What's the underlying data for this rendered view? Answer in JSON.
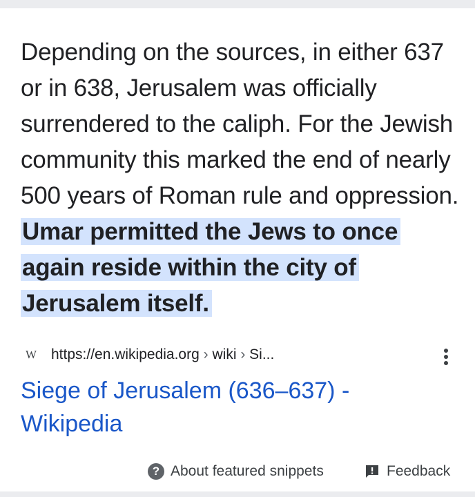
{
  "snippet": {
    "text": "Depending on the sources, in either 637 or in 638, Jerusalem was officially surrendered to the caliph. For the Jewish community this marked the end of nearly 500 years of Roman rule and oppression. ",
    "highlight": "Umar permitted the Jews to once again reside within the city of Jerusalem itself."
  },
  "source": {
    "favicon": "W",
    "url_base": "https://en.wikipedia.org",
    "crumb_1": "wiki",
    "crumb_2": "Si...",
    "separator": "›",
    "more_icon": "more-vertical-icon"
  },
  "result": {
    "title": "Siege of Jerusalem (636–637) - Wikipedia"
  },
  "footer": {
    "about_icon": "?",
    "about_label": "About featured snippets",
    "feedback_label": "Feedback"
  },
  "colors": {
    "highlight_bg": "#d3e3fd",
    "link": "#1a57c8",
    "text": "#202124",
    "page_bg": "#ebecef"
  }
}
